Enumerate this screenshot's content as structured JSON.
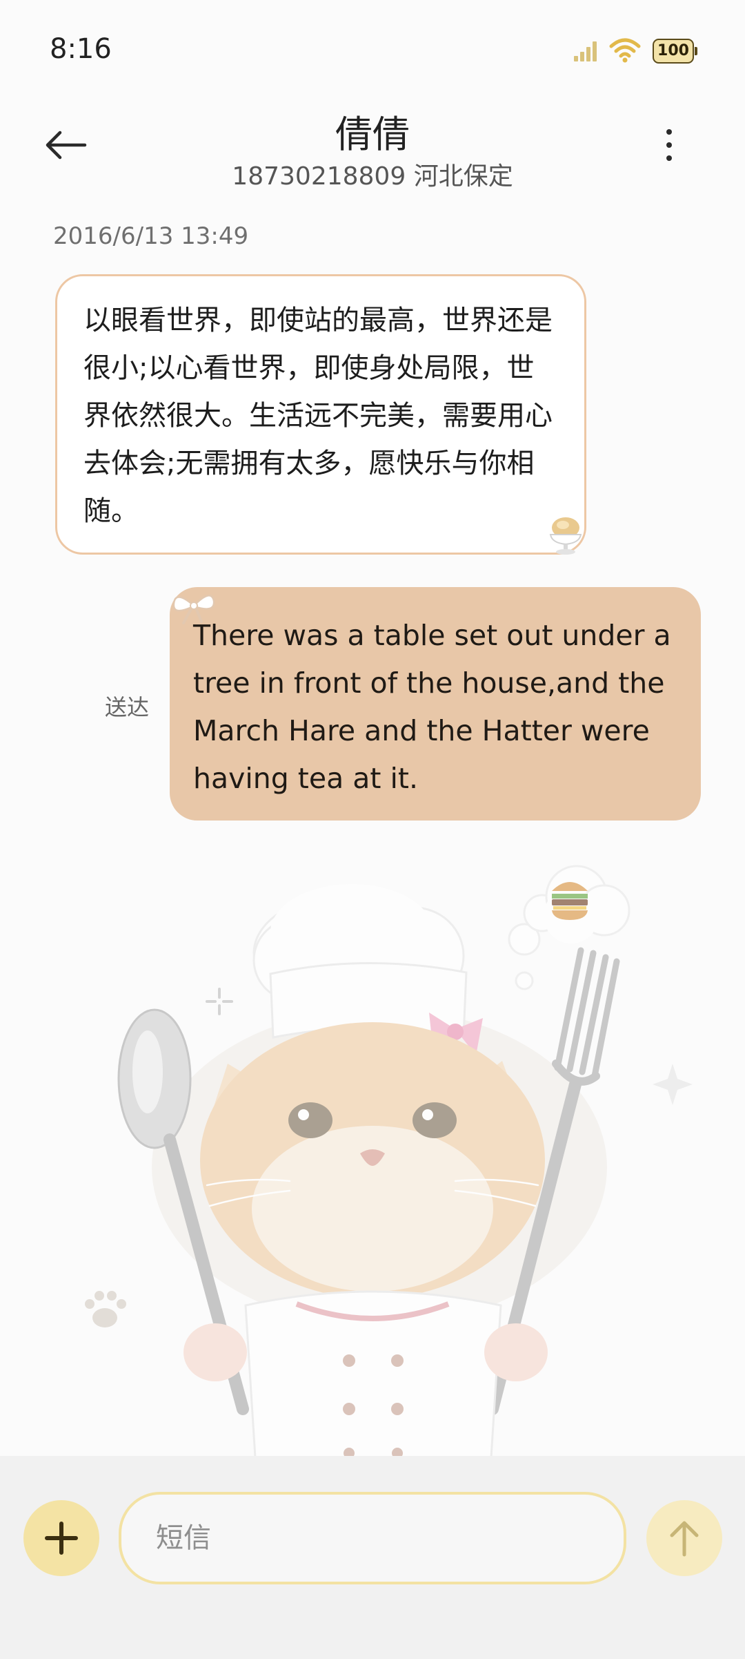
{
  "status_bar": {
    "time": "8:16",
    "battery": "100"
  },
  "header": {
    "contact_name": "倩倩",
    "contact_detail": "18730218809 河北保定"
  },
  "conversation": {
    "timestamp": "2016/6/13 13:49",
    "incoming_message": "以眼看世界，即使站的最高，世界还是很小;以心看世界，即使身处局限，世界依然很大。生活远不完美，需要用心去体会;无需拥有太多，愿快乐与你相随。",
    "outgoing_message": "There was a table set out under a tree in front of the house,and the March Hare and the Hatter were having tea at it.",
    "outgoing_status": "送达"
  },
  "composer": {
    "placeholder": "短信"
  },
  "colors": {
    "incoming_border": "#edc7a4",
    "outgoing_bubble": "#e8c7a8",
    "accent_yellow": "#f4e3a4"
  },
  "icons": {
    "back": "arrow-left-icon",
    "more": "more-vert-icon",
    "add": "plus-icon",
    "send": "arrow-up-icon"
  }
}
